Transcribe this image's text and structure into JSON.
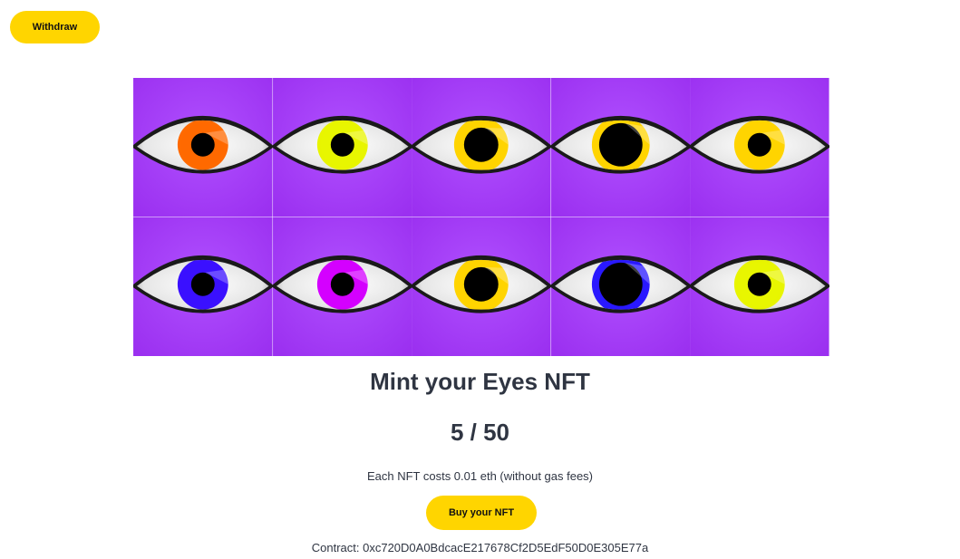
{
  "header": {
    "withdraw_label": "Withdraw"
  },
  "gallery": {
    "tiles": [
      {
        "iris_color": "#ff6a00",
        "pupil": "small"
      },
      {
        "iris_color": "#e8f500",
        "pupil": "small"
      },
      {
        "iris_color": "#ffd400",
        "pupil": "large"
      },
      {
        "iris_color": "#ffd400",
        "pupil": "xlarge"
      },
      {
        "iris_color": "#ffd400",
        "pupil": "small"
      },
      {
        "iris_color": "#3b10ff",
        "pupil": "small"
      },
      {
        "iris_color": "#d400ff",
        "pupil": "small"
      },
      {
        "iris_color": "#ffd400",
        "pupil": "large"
      },
      {
        "iris_color": "#2a18ff",
        "pupil": "xlarge"
      },
      {
        "iris_color": "#e8f500",
        "pupil": "small"
      }
    ],
    "background_color": "#9b30f0"
  },
  "mint": {
    "title": "Mint your Eyes NFT",
    "counter": "5 / 50",
    "price_text": "Each NFT costs 0.01 eth (without gas fees)",
    "buy_label": "Buy your NFT",
    "contract_text": "Contract: 0xc720D0A0BdcacE217678Cf2D5EdF50D0E305E77a"
  },
  "colors": {
    "accent": "#ffd500",
    "text": "#2f3542"
  }
}
